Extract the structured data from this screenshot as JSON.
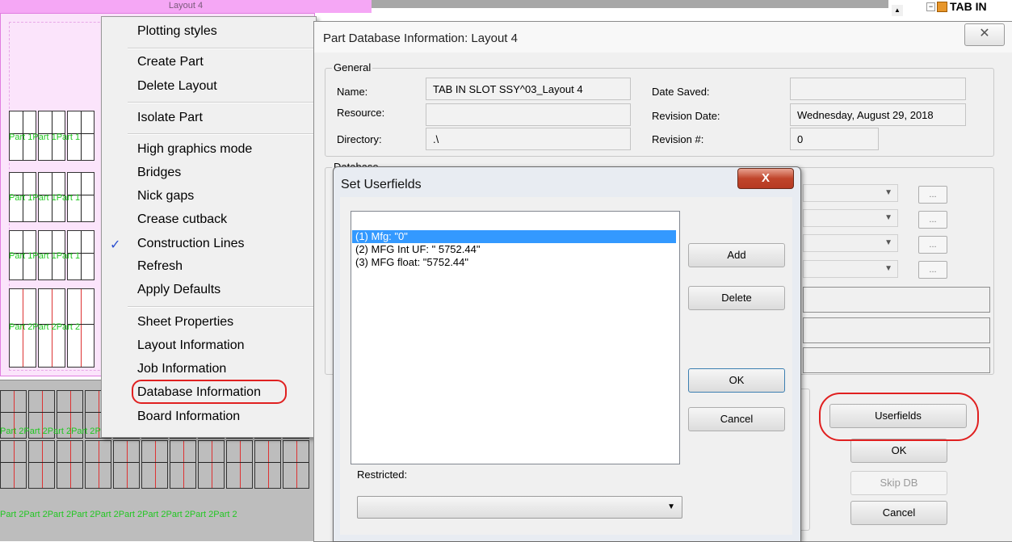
{
  "layout_canvas": {
    "title": "Layout 4",
    "part_label_1": "Part 1",
    "part_label_2": "Part 2"
  },
  "tree": {
    "expander": "−",
    "label": "TAB IN"
  },
  "context_menu": {
    "items": [
      {
        "label": "Plotting styles"
      },
      {
        "label": "Create Part"
      },
      {
        "label": "Delete Layout"
      },
      {
        "label": "Isolate Part"
      },
      {
        "label": "High graphics mode"
      },
      {
        "label": "Bridges"
      },
      {
        "label": "Nick gaps"
      },
      {
        "label": "Crease cutback"
      },
      {
        "label": "Construction Lines",
        "checked": true
      },
      {
        "label": "Refresh"
      },
      {
        "label": "Apply Defaults"
      },
      {
        "label": "Sheet Properties"
      },
      {
        "label": "Layout Information"
      },
      {
        "label": "Job Information"
      },
      {
        "label": "Database Information",
        "highlighted": true
      },
      {
        "label": "Board Information"
      }
    ]
  },
  "part_db_dialog": {
    "title": "Part Database Information: Layout 4",
    "general": {
      "group_label": "General",
      "name_label": "Name:",
      "name_value": "TAB IN SLOT SSY^03_Layout 4",
      "resource_label": "Resource:",
      "resource_value": "",
      "directory_label": "Directory:",
      "directory_value": ".\\",
      "date_saved_label": "Date Saved:",
      "date_saved_value": "",
      "revision_date_label": "Revision Date:",
      "revision_date_value": "Wednesday, August 29, 2018",
      "revision_num_label": "Revision #:",
      "revision_num_value": "0"
    },
    "database_group_label": "Database",
    "dots_label": "...",
    "buttons": {
      "userfields": "Userfields",
      "ok": "OK",
      "skip_db": "Skip DB",
      "cancel": "Cancel"
    }
  },
  "set_userfields_dialog": {
    "title": "Set Userfields",
    "close_glyph": "X",
    "list_items": [
      "(1) Mfg: \"0\"",
      "(2) MFG Int UF: \" 5752.44\"",
      "(3) MFG float: \"5752.44\""
    ],
    "buttons": {
      "add": "Add",
      "delete": "Delete",
      "ok": "OK",
      "cancel": "Cancel"
    },
    "restricted_label": "Restricted:",
    "restricted_value": ""
  }
}
